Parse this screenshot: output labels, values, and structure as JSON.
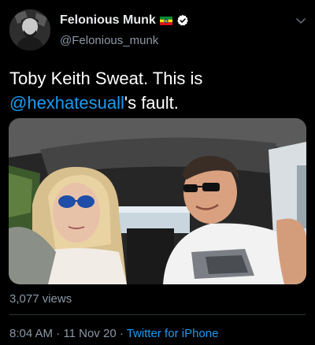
{
  "author": {
    "name": "Felonious Munk",
    "handle": "@Felonious_munk",
    "flag_icon": "ethiopia-flag-icon",
    "verified_icon": "verified-badge-icon"
  },
  "tweet": {
    "text_line1": "Toby Keith Sweat. This is",
    "mention": "@hexhatesuall",
    "text_suffix": "'s fault."
  },
  "media": {
    "type": "video",
    "description_icon": "video-thumbnail"
  },
  "stats": {
    "views": "3,077 views"
  },
  "meta": {
    "time": "8:04 AM",
    "separator1": " · ",
    "date": "11 Nov 20",
    "separator2": " · ",
    "source": "Twitter for iPhone"
  },
  "colors": {
    "background": "#000000",
    "link": "#1d9bf0",
    "secondary_text": "#8b98a5",
    "verified": "#ffffff"
  }
}
